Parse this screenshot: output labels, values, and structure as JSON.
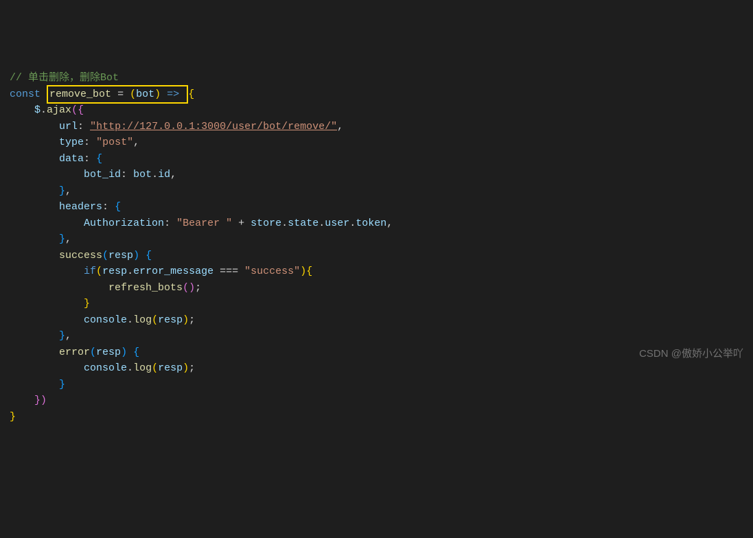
{
  "code": {
    "comment": "// 单击删除，删除Bot",
    "const_kw": "const",
    "fn_name": "remove_bot",
    "param": "bot",
    "arrow": "=>",
    "ajax_call": "$",
    "ajax_method": "ajax",
    "url_key": "url",
    "url_val": "\"http://127.0.0.1:3000/user/bot/remove/\"",
    "type_key": "type",
    "type_val": "\"post\"",
    "data_key": "data",
    "bot_id_key": "bot_id",
    "bot_ref": "bot",
    "id_prop": "id",
    "headers_key": "headers",
    "auth_key": "Authorization",
    "bearer_val": "\"Bearer \"",
    "store_var": "store",
    "state_prop": "state",
    "user_prop": "user",
    "token_prop": "token",
    "success_fn": "success",
    "resp_param": "resp",
    "if_kw": "if",
    "error_msg_prop": "error_message",
    "success_str": "\"success\"",
    "refresh_fn": "refresh_bots",
    "console_var": "console",
    "log_fn": "log",
    "error_fn": "error"
  },
  "watermark": "CSDN @傲娇小公举吖"
}
